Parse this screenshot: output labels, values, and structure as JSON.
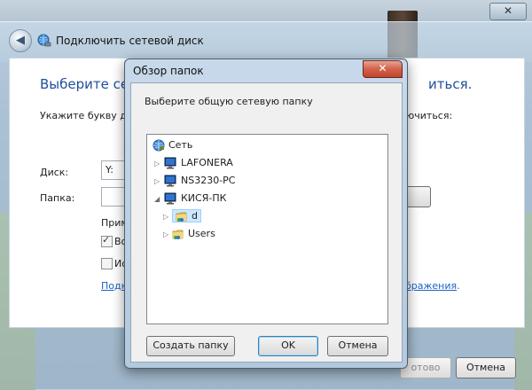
{
  "wizard": {
    "title": "Подключить сетевой диск",
    "close_glyph": "✕",
    "back_glyph": "◀",
    "heading_left": "Выберите сете",
    "heading_right": "иться.",
    "instruction_left": "Укажите букву дис",
    "instruction_right": "ючиться:",
    "disk_label": "Диск:",
    "disk_value": "Y:",
    "folder_label": "Папка:",
    "example_label": "Прим",
    "checkbox1_label": "Во",
    "checkbox1_checked": true,
    "checkbox2_label": "Ис",
    "checkbox2_checked": false,
    "link_left": "Подк",
    "link_right_main": "бражения",
    "link_right_tail": ".",
    "finish_button": "отово",
    "cancel_button": "Отмена"
  },
  "dialog": {
    "title": "Обзор папок",
    "close_glyph": "✕",
    "prompt": "Выберите общую сетевую папку",
    "tree": [
      {
        "label": "Сеть",
        "icon": "network-icon",
        "expanded": true
      },
      {
        "label": "LAFONERA",
        "icon": "computer-icon",
        "expanded": false
      },
      {
        "label": "NS3230-PC",
        "icon": "computer-icon",
        "expanded": false
      },
      {
        "label": "КИСЯ-ПК",
        "icon": "computer-icon",
        "expanded": true
      },
      {
        "label": "d",
        "icon": "shared-folder-icon",
        "expanded": false,
        "selected": true
      },
      {
        "label": "Users",
        "icon": "shared-folder-icon",
        "expanded": false
      }
    ],
    "new_folder_button": "Создать папку",
    "ok_button": "OK",
    "cancel_button": "Отмена"
  },
  "colors": {
    "heading": "#1f4f9c",
    "link": "#1a64c4",
    "selection": "#cde8ff",
    "close_button": "#c0452d"
  }
}
